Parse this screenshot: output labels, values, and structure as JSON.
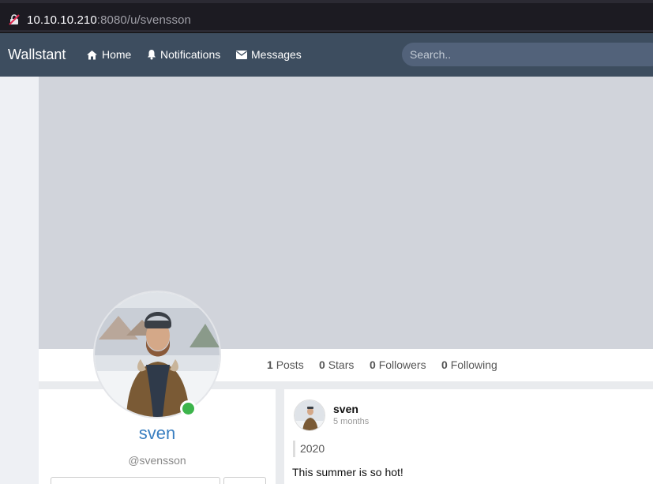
{
  "browser": {
    "url_host": "10.10.10.210",
    "url_rest": ":8080/u/svensson"
  },
  "navbar": {
    "brand": "Wallstant",
    "items": [
      {
        "label": "Home",
        "icon": "home-icon"
      },
      {
        "label": "Notifications",
        "icon": "bell-icon"
      },
      {
        "label": "Messages",
        "icon": "envelope-icon"
      }
    ],
    "search_placeholder": "Search.."
  },
  "stats": {
    "posts_count": "1",
    "posts_label": "Posts",
    "stars_count": "0",
    "stars_label": "Stars",
    "followers_count": "0",
    "followers_label": "Followers",
    "following_count": "0",
    "following_label": "Following"
  },
  "profile": {
    "name": "sven",
    "handle": "@svensson",
    "online_color": "#3cb44b"
  },
  "post": {
    "author": "sven",
    "time": "5 months",
    "quote": "2020",
    "text": "This summer is so hot!"
  },
  "colors": {
    "navbar": "#3d4d5f",
    "cover": "#d1d4db",
    "accent": "#3a7fc1"
  }
}
